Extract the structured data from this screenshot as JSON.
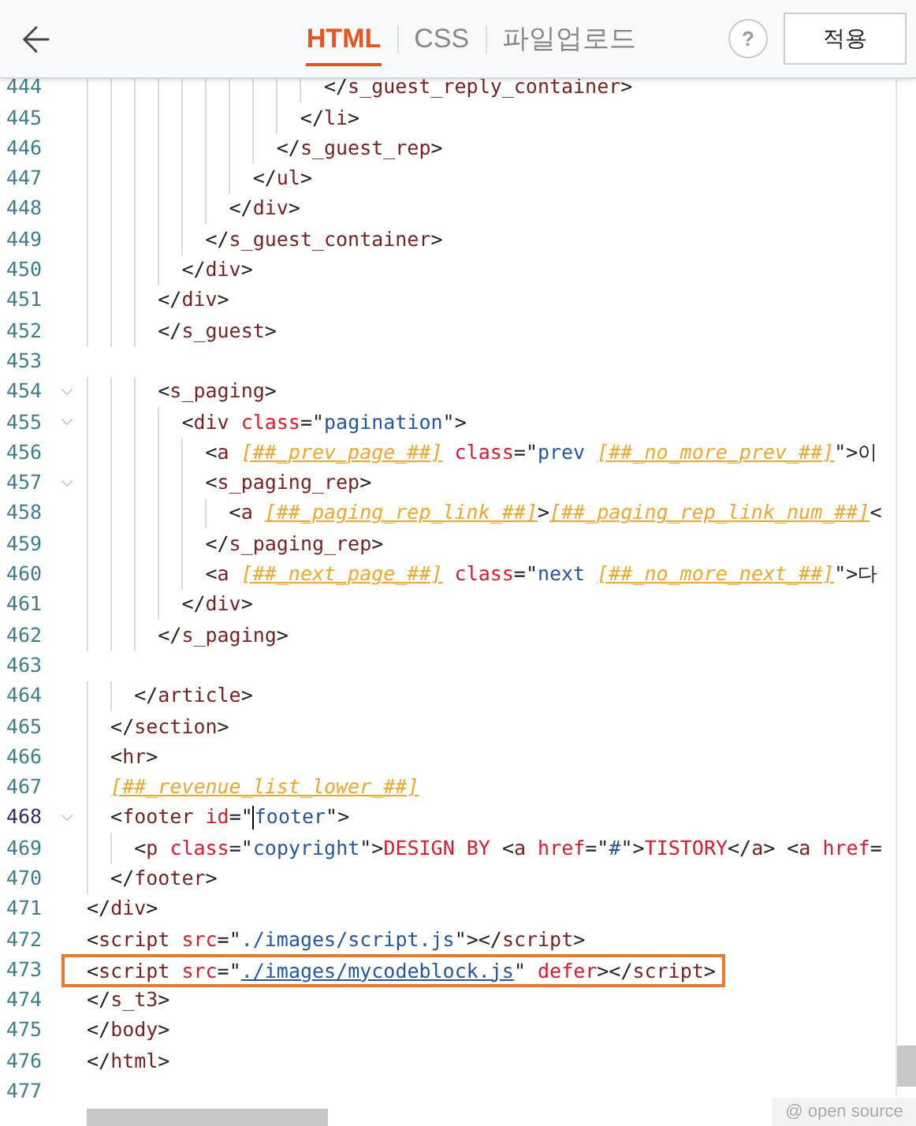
{
  "header": {
    "tabs": [
      {
        "label": "HTML",
        "selected": true
      },
      {
        "label": "CSS",
        "selected": false
      },
      {
        "label": "파일업로드",
        "selected": false
      }
    ],
    "help": "?",
    "apply_button": "적용"
  },
  "editor": {
    "lines": [
      {
        "n": "444",
        "fold": false,
        "tokens": [
          {
            "kind": "p",
            "text": "                    </"
          },
          {
            "kind": "tag",
            "text": "s_guest_reply_container"
          },
          {
            "kind": "p",
            "text": ">"
          }
        ]
      },
      {
        "n": "445",
        "fold": false,
        "tokens": [
          {
            "kind": "p",
            "text": "                  </"
          },
          {
            "kind": "tag",
            "text": "li"
          },
          {
            "kind": "p",
            "text": ">"
          }
        ]
      },
      {
        "n": "446",
        "fold": false,
        "tokens": [
          {
            "kind": "p",
            "text": "                </"
          },
          {
            "kind": "tag",
            "text": "s_guest_rep"
          },
          {
            "kind": "p",
            "text": ">"
          }
        ]
      },
      {
        "n": "447",
        "fold": false,
        "tokens": [
          {
            "kind": "p",
            "text": "              </"
          },
          {
            "kind": "tag",
            "text": "ul"
          },
          {
            "kind": "p",
            "text": ">"
          }
        ]
      },
      {
        "n": "448",
        "fold": false,
        "tokens": [
          {
            "kind": "p",
            "text": "            </"
          },
          {
            "kind": "tag",
            "text": "div"
          },
          {
            "kind": "p",
            "text": ">"
          }
        ]
      },
      {
        "n": "449",
        "fold": false,
        "tokens": [
          {
            "kind": "p",
            "text": "          </"
          },
          {
            "kind": "tag",
            "text": "s_guest_container"
          },
          {
            "kind": "p",
            "text": ">"
          }
        ]
      },
      {
        "n": "450",
        "fold": false,
        "tokens": [
          {
            "kind": "p",
            "text": "        </"
          },
          {
            "kind": "tag",
            "text": "div"
          },
          {
            "kind": "p",
            "text": ">"
          }
        ]
      },
      {
        "n": "451",
        "fold": false,
        "tokens": [
          {
            "kind": "p",
            "text": "      </"
          },
          {
            "kind": "tag",
            "text": "div"
          },
          {
            "kind": "p",
            "text": ">"
          }
        ]
      },
      {
        "n": "452",
        "fold": false,
        "tokens": [
          {
            "kind": "p",
            "text": "      </"
          },
          {
            "kind": "tag",
            "text": "s_guest"
          },
          {
            "kind": "p",
            "text": ">"
          }
        ]
      },
      {
        "n": "453",
        "fold": false
      },
      {
        "n": "454",
        "fold": true,
        "tokens": [
          {
            "kind": "p",
            "text": "      <"
          },
          {
            "kind": "tag",
            "text": "s_paging"
          },
          {
            "kind": "p",
            "text": ">"
          }
        ]
      },
      {
        "n": "455",
        "fold": true,
        "tokens": [
          {
            "kind": "p",
            "text": "        <"
          },
          {
            "kind": "tag",
            "text": "div "
          },
          {
            "kind": "attr",
            "text": "class"
          },
          {
            "kind": "p",
            "text": "=\""
          },
          {
            "kind": "str",
            "text": "pagination"
          },
          {
            "kind": "p",
            "text": "\">"
          }
        ]
      },
      {
        "n": "456",
        "fold": false,
        "tokens": [
          {
            "kind": "p",
            "text": "          <"
          },
          {
            "kind": "tag",
            "text": "a "
          },
          {
            "kind": "tpl",
            "text": "[##_prev_page_##]"
          },
          {
            "kind": "attr",
            "text": " class"
          },
          {
            "kind": "p",
            "text": "=\""
          },
          {
            "kind": "str",
            "text": "prev "
          },
          {
            "kind": "tpl",
            "text": "[##_no_more_prev_##]"
          },
          {
            "kind": "p",
            "text": "\">이"
          }
        ]
      },
      {
        "n": "457",
        "fold": true,
        "tokens": [
          {
            "kind": "p",
            "text": "          <"
          },
          {
            "kind": "tag",
            "text": "s_paging_rep"
          },
          {
            "kind": "p",
            "text": ">"
          }
        ]
      },
      {
        "n": "458",
        "fold": false,
        "tokens": [
          {
            "kind": "p",
            "text": "            <"
          },
          {
            "kind": "tag",
            "text": "a "
          },
          {
            "kind": "tpl",
            "text": "[##_paging_rep_link_##]"
          },
          {
            "kind": "p",
            "text": ">"
          },
          {
            "kind": "tpl",
            "text": "[##_paging_rep_link_num_##]"
          },
          {
            "kind": "p",
            "text": "<"
          }
        ]
      },
      {
        "n": "459",
        "fold": false,
        "tokens": [
          {
            "kind": "p",
            "text": "          </"
          },
          {
            "kind": "tag",
            "text": "s_paging_rep"
          },
          {
            "kind": "p",
            "text": ">"
          }
        ]
      },
      {
        "n": "460",
        "fold": false,
        "tokens": [
          {
            "kind": "p",
            "text": "          <"
          },
          {
            "kind": "tag",
            "text": "a "
          },
          {
            "kind": "tpl",
            "text": "[##_next_page_##]"
          },
          {
            "kind": "attr",
            "text": " class"
          },
          {
            "kind": "p",
            "text": "=\""
          },
          {
            "kind": "str",
            "text": "next "
          },
          {
            "kind": "tpl",
            "text": "[##_no_more_next_##]"
          },
          {
            "kind": "p",
            "text": "\">다"
          }
        ]
      },
      {
        "n": "461",
        "fold": false,
        "tokens": [
          {
            "kind": "p",
            "text": "        </"
          },
          {
            "kind": "tag",
            "text": "div"
          },
          {
            "kind": "p",
            "text": ">"
          }
        ]
      },
      {
        "n": "462",
        "fold": false,
        "tokens": [
          {
            "kind": "p",
            "text": "      </"
          },
          {
            "kind": "tag",
            "text": "s_paging"
          },
          {
            "kind": "p",
            "text": ">"
          }
        ]
      },
      {
        "n": "463",
        "fold": false
      },
      {
        "n": "464",
        "fold": false,
        "tokens": [
          {
            "kind": "p",
            "text": "    </"
          },
          {
            "kind": "tag",
            "text": "article"
          },
          {
            "kind": "p",
            "text": ">"
          }
        ]
      },
      {
        "n": "465",
        "fold": false,
        "tokens": [
          {
            "kind": "p",
            "text": "  </"
          },
          {
            "kind": "tag",
            "text": "section"
          },
          {
            "kind": "p",
            "text": ">"
          }
        ]
      },
      {
        "n": "466",
        "fold": false,
        "tokens": [
          {
            "kind": "p",
            "text": "  <"
          },
          {
            "kind": "tag",
            "text": "hr"
          },
          {
            "kind": "p",
            "text": ">"
          }
        ]
      },
      {
        "n": "467",
        "fold": false,
        "tokens": [
          {
            "kind": "tpl",
            "text": "  [##_revenue_list_lower_##]"
          }
        ]
      },
      {
        "n": "468",
        "fold": true,
        "current": true,
        "tokens": [
          {
            "kind": "p",
            "text": "  <"
          },
          {
            "kind": "tag",
            "text": "footer "
          },
          {
            "kind": "attr",
            "text": "id"
          },
          {
            "kind": "p",
            "text": "=\""
          },
          {
            "kind": "cursor"
          },
          {
            "kind": "str",
            "text": "footer"
          },
          {
            "kind": "p",
            "text": "\">"
          }
        ]
      },
      {
        "n": "469",
        "fold": false,
        "tokens": [
          {
            "kind": "p",
            "text": "    <"
          },
          {
            "kind": "tag",
            "text": "p "
          },
          {
            "kind": "attr",
            "text": "class"
          },
          {
            "kind": "p",
            "text": "=\""
          },
          {
            "kind": "str",
            "text": "copyright"
          },
          {
            "kind": "p",
            "text": "\">"
          },
          {
            "kind": "content",
            "text": "DESIGN BY "
          },
          {
            "kind": "p",
            "text": "<"
          },
          {
            "kind": "tag",
            "text": "a "
          },
          {
            "kind": "attr",
            "text": "href"
          },
          {
            "kind": "p",
            "text": "=\""
          },
          {
            "kind": "str",
            "text": "#"
          },
          {
            "kind": "p",
            "text": "\">"
          },
          {
            "kind": "content",
            "text": "TISTORY"
          },
          {
            "kind": "p",
            "text": "</"
          },
          {
            "kind": "tag",
            "text": "a"
          },
          {
            "kind": "p",
            "text": "> <"
          },
          {
            "kind": "tag",
            "text": "a "
          },
          {
            "kind": "attr",
            "text": "href"
          },
          {
            "kind": "p",
            "text": "="
          }
        ]
      },
      {
        "n": "470",
        "fold": false,
        "tokens": [
          {
            "kind": "p",
            "text": "  </"
          },
          {
            "kind": "tag",
            "text": "footer"
          },
          {
            "kind": "p",
            "text": ">"
          }
        ]
      },
      {
        "n": "471",
        "fold": false,
        "tokens": [
          {
            "kind": "p",
            "text": "</"
          },
          {
            "kind": "tag",
            "text": "div"
          },
          {
            "kind": "p",
            "text": ">"
          }
        ]
      },
      {
        "n": "472",
        "fold": false,
        "tokens": [
          {
            "kind": "p",
            "text": "<"
          },
          {
            "kind": "tag",
            "text": "script "
          },
          {
            "kind": "attr",
            "text": "src"
          },
          {
            "kind": "p",
            "text": "=\""
          },
          {
            "kind": "str",
            "text": "./images/script.js"
          },
          {
            "kind": "p",
            "text": "\"></"
          },
          {
            "kind": "tag",
            "text": "script"
          },
          {
            "kind": "p",
            "text": ">"
          }
        ]
      },
      {
        "n": "473",
        "fold": false,
        "boxed": true,
        "tokens": [
          {
            "kind": "p",
            "text": "<"
          },
          {
            "kind": "tag",
            "text": "script "
          },
          {
            "kind": "attr",
            "text": "src"
          },
          {
            "kind": "p",
            "text": "=\""
          },
          {
            "kind": "link",
            "text": "./images/mycodeblock.js"
          },
          {
            "kind": "p",
            "text": "\" "
          },
          {
            "kind": "attr",
            "text": "defer"
          },
          {
            "kind": "p",
            "text": "></"
          },
          {
            "kind": "tag",
            "text": "script"
          },
          {
            "kind": "p",
            "text": ">"
          }
        ]
      },
      {
        "n": "474",
        "fold": false,
        "tokens": [
          {
            "kind": "p",
            "text": "</"
          },
          {
            "kind": "tag",
            "text": "s_t3"
          },
          {
            "kind": "p",
            "text": ">"
          }
        ]
      },
      {
        "n": "475",
        "fold": false,
        "tokens": [
          {
            "kind": "p",
            "text": "</"
          },
          {
            "kind": "tag",
            "text": "body"
          },
          {
            "kind": "p",
            "text": ">"
          }
        ]
      },
      {
        "n": "476",
        "fold": false,
        "tokens": [
          {
            "kind": "p",
            "text": "</"
          },
          {
            "kind": "tag",
            "text": "html"
          },
          {
            "kind": "p",
            "text": ">"
          }
        ]
      },
      {
        "n": "477",
        "fold": false
      }
    ]
  },
  "footer_label": "@ open source"
}
